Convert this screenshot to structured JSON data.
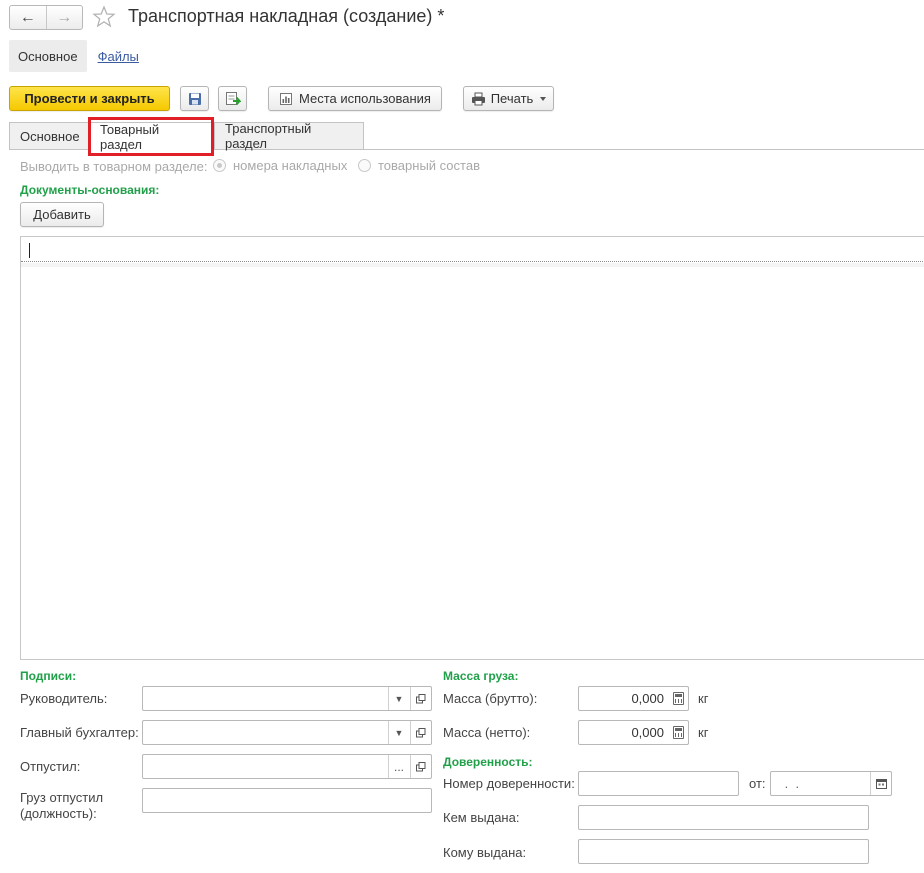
{
  "window": {
    "title": "Транспортная накладная (создание) *",
    "back_glyph": "←",
    "forward_glyph": "→"
  },
  "section_links": {
    "main": "Основное",
    "files": "Файлы"
  },
  "toolbar": {
    "post_close_label": "Провести и закрыть",
    "usage_places_label": "Места использования",
    "print_label": "Печать"
  },
  "tabs": [
    {
      "label": "Основное"
    },
    {
      "label": "Товарный раздел"
    },
    {
      "label": "Транспортный раздел"
    }
  ],
  "goods_section": {
    "output_label": "Выводить в товарном разделе:",
    "option_invoice_numbers": "номера накладных",
    "option_goods_list": "товарный состав",
    "selected_option": "номера накладных"
  },
  "base_documents": {
    "header": "Документы-основания:",
    "add_label": "Добавить"
  },
  "signatures": {
    "header": "Подписи:",
    "manager_label": "Руководитель:",
    "chief_accountant_label": "Главный бухгалтер:",
    "released_label": "Отпустил:",
    "released_by_position_label": "Груз отпустил (должность):",
    "ellipsis": "..."
  },
  "cargo_mass": {
    "header": "Масса груза:",
    "gross_label": "Масса (брутто):",
    "gross_value": "0,000",
    "net_label": "Масса (нетто):",
    "net_value": "0,000",
    "unit": "кг"
  },
  "power_of_attorney": {
    "header": "Доверенность:",
    "number_label": "Номер доверенности:",
    "from_label": "от:",
    "date_placeholder": " .  .",
    "issued_by_label": "Кем выдана:",
    "issued_to_label": "Кому выдана:"
  },
  "colors": {
    "accent_green": "#21a04a",
    "primary_yellow": "#f5c900",
    "highlight_red": "#e01f26",
    "link_blue": "#3a5ba2"
  },
  "icons": [
    "back-arrow-icon",
    "forward-arrow-icon",
    "favorite-star-icon",
    "save-icon",
    "post-icon",
    "report-icon",
    "printer-icon",
    "dropdown-icon",
    "open-icon",
    "calculator-icon",
    "calendar-icon"
  ]
}
